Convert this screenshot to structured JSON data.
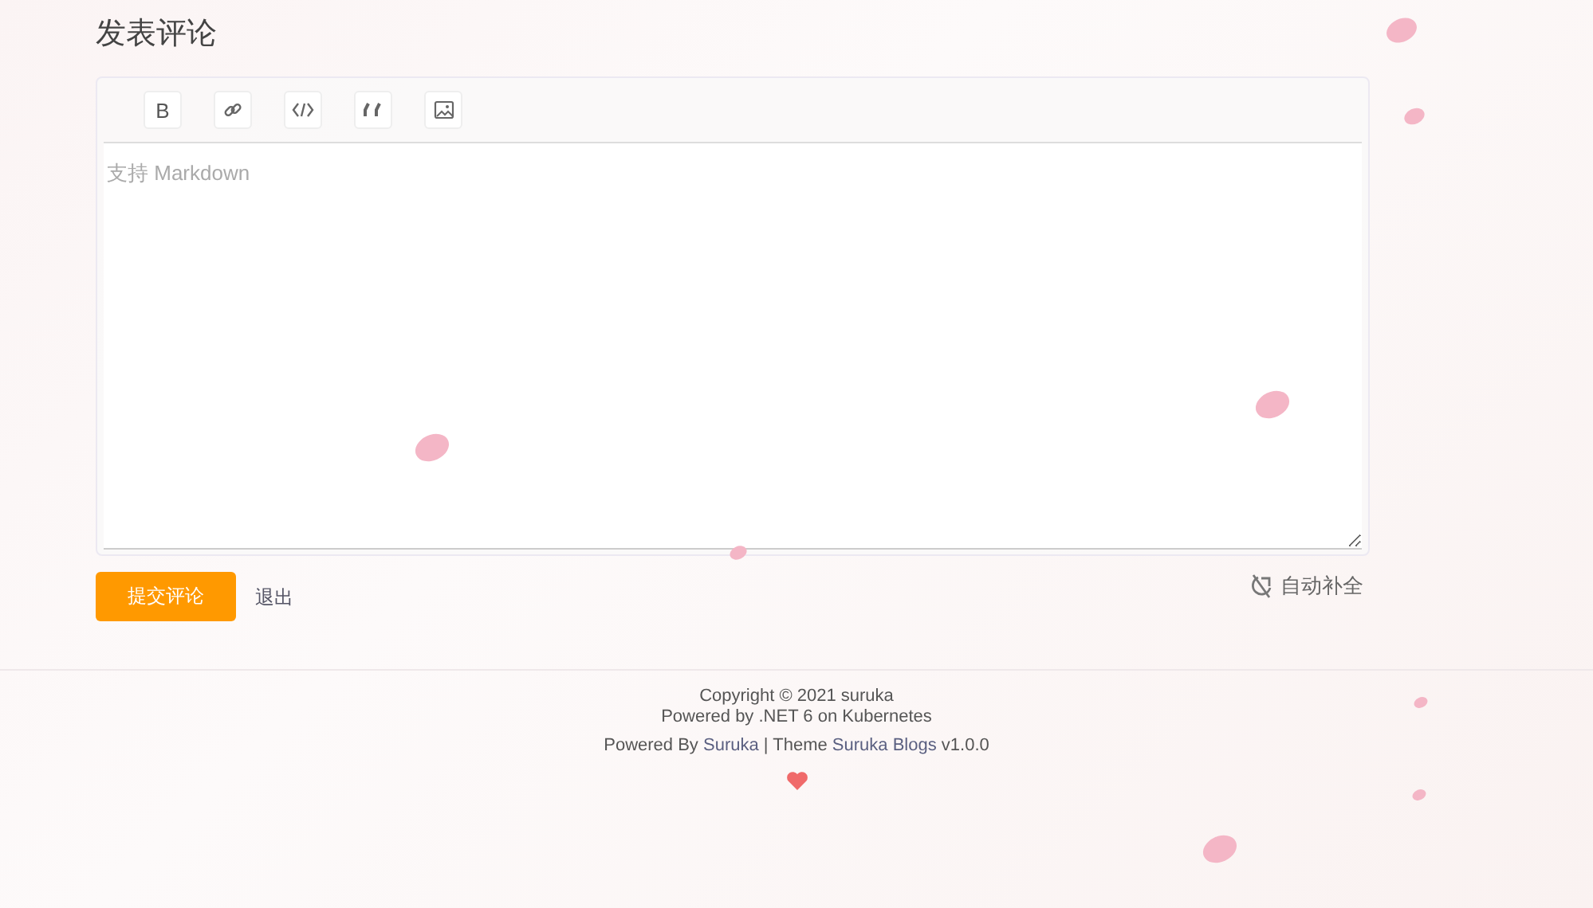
{
  "heading": "发表评论",
  "toolbar": [
    {
      "kind": "bold",
      "label": "B"
    },
    {
      "kind": "link"
    },
    {
      "kind": "code"
    },
    {
      "kind": "quote"
    },
    {
      "kind": "image"
    }
  ],
  "editor": {
    "placeholder": "支持 Markdown"
  },
  "submit_button": "提交评论",
  "logout_link": "退出",
  "autocomplete": {
    "label": "自动补全",
    "on": false
  },
  "footer": {
    "copyright": "Copyright © 2021 suruka",
    "powered": "Powered by .NET 6 on Kubernetes",
    "credits": {
      "before": "Powered By",
      "author_link": "Suruka",
      "middle": "| Theme",
      "theme_link": "Suruka Blogs",
      "version": "v1.0.0"
    }
  }
}
